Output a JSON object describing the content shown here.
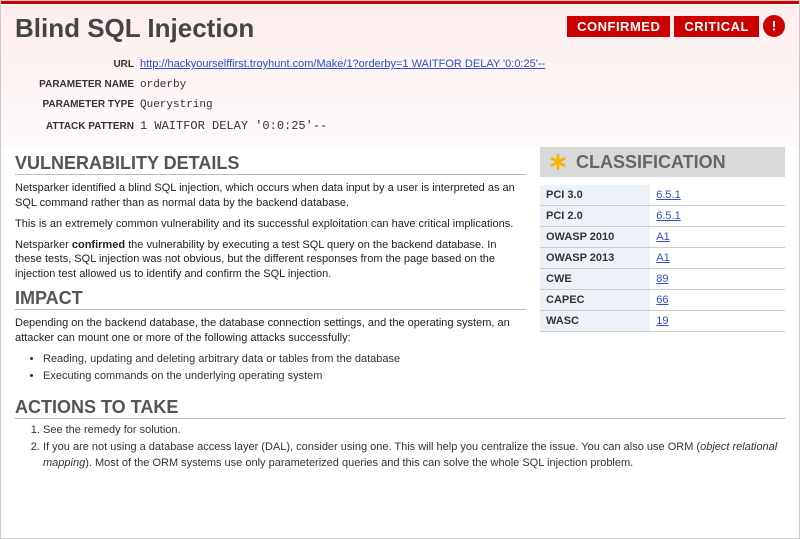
{
  "title": "Blind SQL Injection",
  "badges": {
    "confirmed": "CONFIRMED",
    "critical": "CRITICAL"
  },
  "info": {
    "url_label": "URL",
    "url_value": "http://hackyourselffirst.troyhunt.com/Make/1?orderby=1 WAITFOR DELAY '0:0:25'--",
    "param_name_label": "PARAMETER NAME",
    "param_name_value": "orderby",
    "param_type_label": "PARAMETER TYPE",
    "param_type_value": "Querystring",
    "attack_label": "ATTACK PATTERN",
    "attack_value": "1 WAITFOR DELAY '0:0:25'--"
  },
  "sections": {
    "vuln_heading": "VULNERABILITY DETAILS",
    "vuln_p1": "Netsparker identified a blind SQL injection, which occurs when data input by a user is interpreted as an SQL command rather than as normal data by the backend database.",
    "vuln_p2": "This is an extremely common vulnerability and its successful exploitation can have critical implications.",
    "vuln_p3a": "Netsparker ",
    "vuln_p3b": "confirmed",
    "vuln_p3c": " the vulnerability by executing a test SQL query on the backend database. In these tests, SQL injection was not obvious, but the different responses from the page based on the injection test allowed us to identify and confirm the SQL injection.",
    "impact_heading": "IMPACT",
    "impact_p": "Depending on the backend database, the database connection settings, and the operating system, an attacker can mount one or more of the following attacks successfully:",
    "impact_li1": "Reading, updating and deleting arbitrary data or tables from the database",
    "impact_li2": "Executing commands on the underlying operating system",
    "actions_heading": "ACTIONS TO TAKE",
    "actions_li1": "See the remedy for solution.",
    "actions_li2a": "If you are not using a database access layer (DAL), consider using one. This will help you centralize the issue. You can also use ORM (",
    "actions_li2b": "object relational mapping",
    "actions_li2c": "). Most of the ORM systems use only parameterized queries and this can solve the whole SQL injection problem."
  },
  "classification": {
    "heading": "CLASSIFICATION",
    "rows": [
      {
        "label": "PCI 3.0",
        "value": "6.5.1"
      },
      {
        "label": "PCI 2.0",
        "value": "6.5.1"
      },
      {
        "label": "OWASP 2010",
        "value": "A1"
      },
      {
        "label": "OWASP 2013",
        "value": "A1"
      },
      {
        "label": "CWE",
        "value": "89"
      },
      {
        "label": "CAPEC",
        "value": "66"
      },
      {
        "label": "WASC",
        "value": "19"
      }
    ]
  }
}
